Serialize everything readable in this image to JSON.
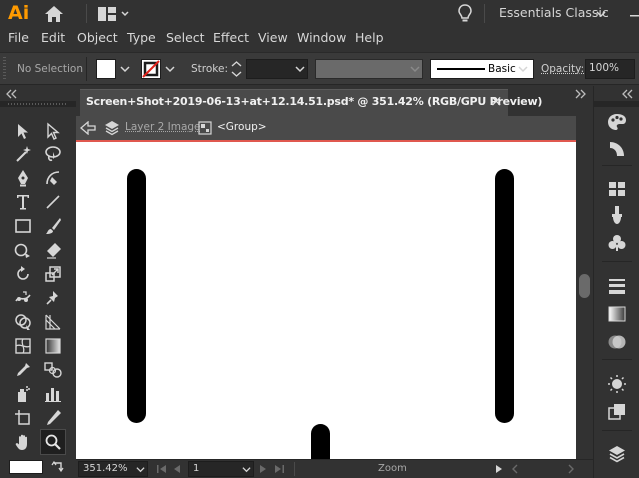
{
  "app": {
    "logo": "Ai",
    "workspace": "Essentials Classic"
  },
  "menu": [
    "File",
    "Edit",
    "Object",
    "Type",
    "Select",
    "Effect",
    "View",
    "Window",
    "Help"
  ],
  "control": {
    "selection": "No Selection",
    "stroke_label": "Stroke:",
    "brush_label": "Basic",
    "opacity_label": "Opacity:",
    "opacity_value": "100%"
  },
  "document": {
    "tab_title": "Screen+Shot+2019-06-13+at+12.14.51.psd* @ 351.42% (RGB/GPU Preview)",
    "close_symbol": "×",
    "layer_name": "Layer 2 Image",
    "group_name": "<Group>"
  },
  "status": {
    "zoom": "351.42%",
    "artboard": "1",
    "tool_name": "Zoom"
  },
  "colors": {
    "accent_logo": "#ff9a00",
    "artboard_edge": "#e0584f"
  }
}
